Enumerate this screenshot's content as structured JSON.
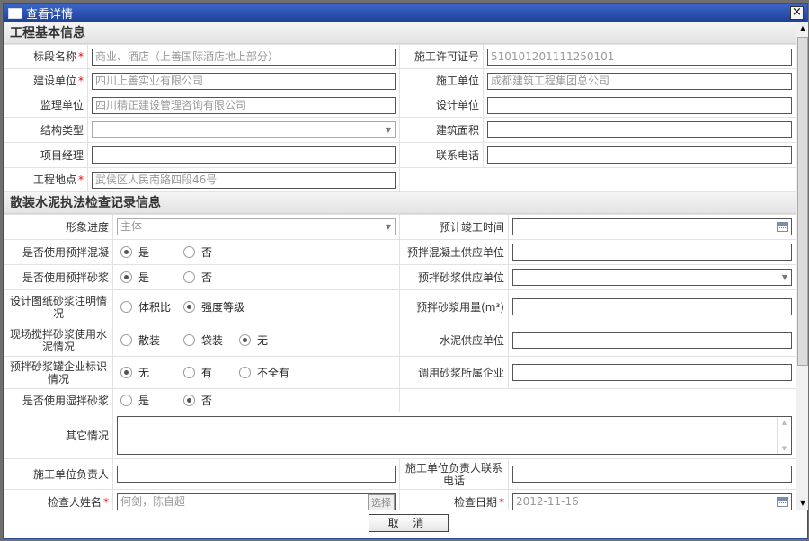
{
  "window": {
    "title": "查看详情",
    "close_label": "×"
  },
  "section1": {
    "title": "工程基本信息",
    "rows": [
      {
        "left": {
          "label": "标段名称",
          "req": "*",
          "value": "商业、酒店（上善国际酒店地上部分）"
        },
        "right": {
          "label": "施工许可证号",
          "value": "510101201111250101"
        }
      },
      {
        "left": {
          "label": "建设单位",
          "req": "*",
          "value": "四川上善实业有限公司"
        },
        "right": {
          "label": "施工单位",
          "value": "成都建筑工程集团总公司"
        }
      },
      {
        "left": {
          "label": "监理单位",
          "value": "四川精正建设管理咨询有限公司"
        },
        "right": {
          "label": "设计单位",
          "value": ""
        }
      },
      {
        "left": {
          "label": "结构类型",
          "value": ""
        },
        "right": {
          "label": "建筑面积",
          "value": ""
        }
      },
      {
        "left": {
          "label": "项目经理",
          "value": ""
        },
        "right": {
          "label": "联系电话",
          "value": ""
        }
      },
      {
        "left": {
          "label": "工程地点",
          "req": "*",
          "value": "武侯区人民南路四段46号"
        }
      }
    ]
  },
  "section2": {
    "title": "散装水泥执法检查记录信息",
    "progress": {
      "label": "形象进度",
      "value": "主体"
    },
    "completion": {
      "label": "预计竣工时间",
      "value": ""
    },
    "premix_concrete": {
      "label": "是否使用预拌混凝",
      "options": [
        "是",
        "否"
      ],
      "selected": "是"
    },
    "concrete_supplier": {
      "label": "预拌混凝土供应单位",
      "value": ""
    },
    "premix_mortar": {
      "label": "是否使用预拌砂浆",
      "options": [
        "是",
        "否"
      ],
      "selected": "是"
    },
    "mortar_supplier": {
      "label": "预拌砂浆供应单位",
      "value": ""
    },
    "design_note": {
      "label": "设计图纸砂浆注明情况",
      "options": [
        "体积比",
        "强度等级"
      ],
      "selected": "强度等级"
    },
    "mortar_usage": {
      "label": "预拌砂浆用量(m³)",
      "value": ""
    },
    "site_mix": {
      "label": "现场搅拌砂浆使用水泥情况",
      "options": [
        "散装",
        "袋装",
        "无"
      ],
      "selected": "无"
    },
    "cement_supplier": {
      "label": "水泥供应单位",
      "value": ""
    },
    "tank_logo": {
      "label": "预拌砂浆罐企业标识情况",
      "options": [
        "无",
        "有",
        "不全有"
      ],
      "selected": "无"
    },
    "mortar_company": {
      "label": "调用砂浆所属企业",
      "value": ""
    },
    "wet_mortar": {
      "label": "是否使用湿拌砂浆",
      "options": [
        "是",
        "否"
      ],
      "selected": "否"
    },
    "other": {
      "label": "其它情况",
      "value": ""
    },
    "contractor_lead": {
      "label": "施工单位负责人",
      "value": ""
    },
    "contractor_phone": {
      "label": "施工单位负责人联系电话",
      "value": ""
    },
    "inspector": {
      "label": "检查人姓名",
      "req": "*",
      "value": "何剑，陈自超",
      "select_label": "选择"
    },
    "inspect_date": {
      "label": "检查日期",
      "req": "*",
      "value": "2012-11-16"
    }
  },
  "footer": {
    "cancel_label": "取 消"
  }
}
